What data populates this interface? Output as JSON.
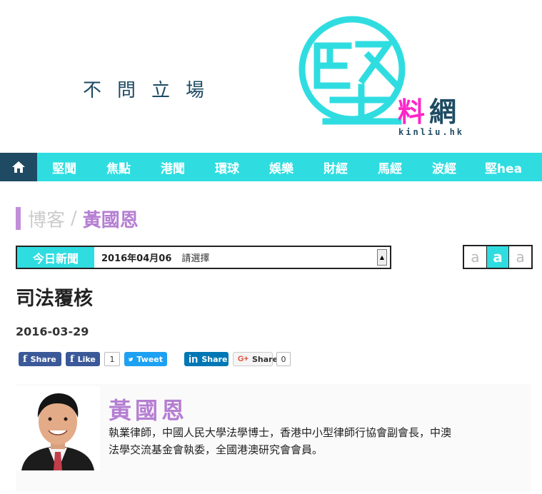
{
  "header": {
    "slogan": "不問立場",
    "logo_main": "堅",
    "logo_sub_1": "料",
    "logo_sub_2": "網",
    "logo_domain": "kinliu.hk"
  },
  "nav": {
    "home_icon": "home-icon",
    "items": [
      "堅聞",
      "焦點",
      "港聞",
      "環球",
      "娛樂",
      "財經",
      "馬經",
      "波經",
      "堅hea"
    ]
  },
  "breadcrumb": {
    "section": "博客",
    "separator": "/",
    "current": "黃國恩"
  },
  "datebar": {
    "label": "今日新聞",
    "date": "2016年04月06",
    "select_placeholder": "請選擇"
  },
  "font_sizes": [
    "a",
    "a",
    "a"
  ],
  "article": {
    "title": "司法覆核",
    "date": "2016-03-29"
  },
  "social": {
    "fb_share": "Share",
    "fb_like": "Like",
    "fb_like_count": "1",
    "tweet": "Tweet",
    "linkedin_share": "Share",
    "gplus_share": "Share",
    "gplus_count": "0"
  },
  "author": {
    "name": "黃國恩",
    "bio": "執業律師，中國人民大學法學博士，香港中小型律師行協會副會長，中澳法學交流基金會執委，全國港澳研究會會員。"
  },
  "colors": {
    "accent": "#2fdde1",
    "navy": "#1e4b63",
    "purple": "#b57ed2",
    "pink": "#ff25c9"
  }
}
